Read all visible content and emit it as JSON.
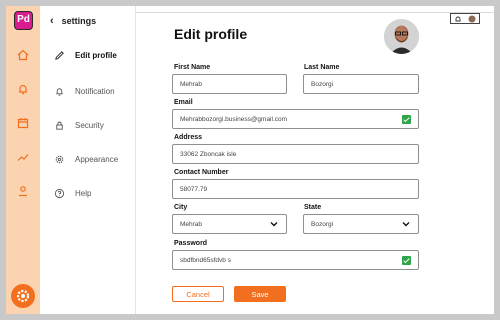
{
  "app": {
    "logo_text": "Pd"
  },
  "settings_panel": {
    "title": "settings",
    "items": [
      {
        "label": "Edit profile",
        "icon": "pencil-icon",
        "active": true
      },
      {
        "label": "Notification",
        "icon": "bell-icon",
        "active": false
      },
      {
        "label": "Security",
        "icon": "lock-icon",
        "active": false
      },
      {
        "label": "Appearance",
        "icon": "gear-icon",
        "active": false
      },
      {
        "label": "Help",
        "icon": "help-circle-icon",
        "active": false
      }
    ]
  },
  "page": {
    "title": "Edit profile"
  },
  "form": {
    "first_name": {
      "label": "First Name",
      "value": "Mehrab"
    },
    "last_name": {
      "label": "Last Name",
      "value": "Bozorgi"
    },
    "email": {
      "label": "Email",
      "value": "Mehrabbozorgi.business@gmail.com"
    },
    "address": {
      "label": "Address",
      "value": "33062 Zboncak isle"
    },
    "contact": {
      "label": "Contact Number",
      "value": "58077.79"
    },
    "city": {
      "label": "City",
      "value": "Mehrab"
    },
    "state": {
      "label": "State",
      "value": "Bozorgi"
    },
    "password": {
      "label": "Password",
      "value": "sbdfbnd65sfdvb s"
    }
  },
  "actions": {
    "cancel_label": "Cancel",
    "save_label": "Save"
  },
  "colors": {
    "accent": "#f26f1f",
    "rail_bg": "#fcd3b0",
    "check_green": "#2fa54a",
    "logo_bg": "#d61c8e"
  }
}
